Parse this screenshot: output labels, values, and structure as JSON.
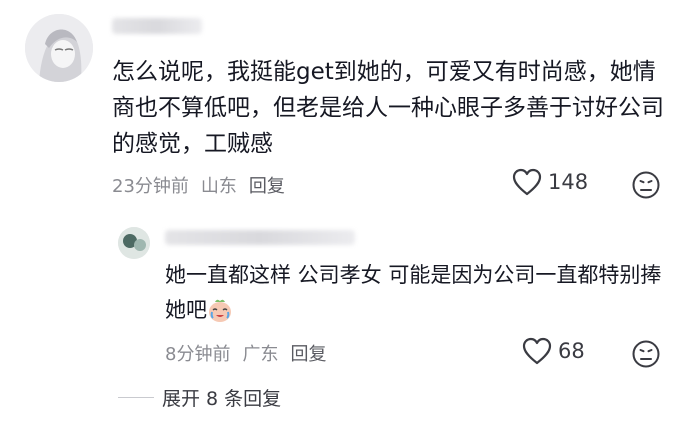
{
  "comment": {
    "text": "怎么说呢，我挺能get到她的，可爱又有时尚感，她情商也不算低吧，但老是给人一种心眼子多善于讨好公司的感觉，工贼感",
    "time": "23分钟前",
    "location": "山东",
    "reply_label": "回复",
    "likes": "148"
  },
  "reply": {
    "text": "她一直都这样 公司孝女 可能是因为公司一直都特别捧她吧",
    "emoji_icon": "crying-laughing-emoji-icon",
    "time": "8分钟前",
    "location": "广东",
    "reply_label": "回复",
    "likes": "68"
  },
  "expand_label": "展开 8 条回复",
  "colors": {
    "text": "#161823",
    "meta": "#8a8b91"
  }
}
